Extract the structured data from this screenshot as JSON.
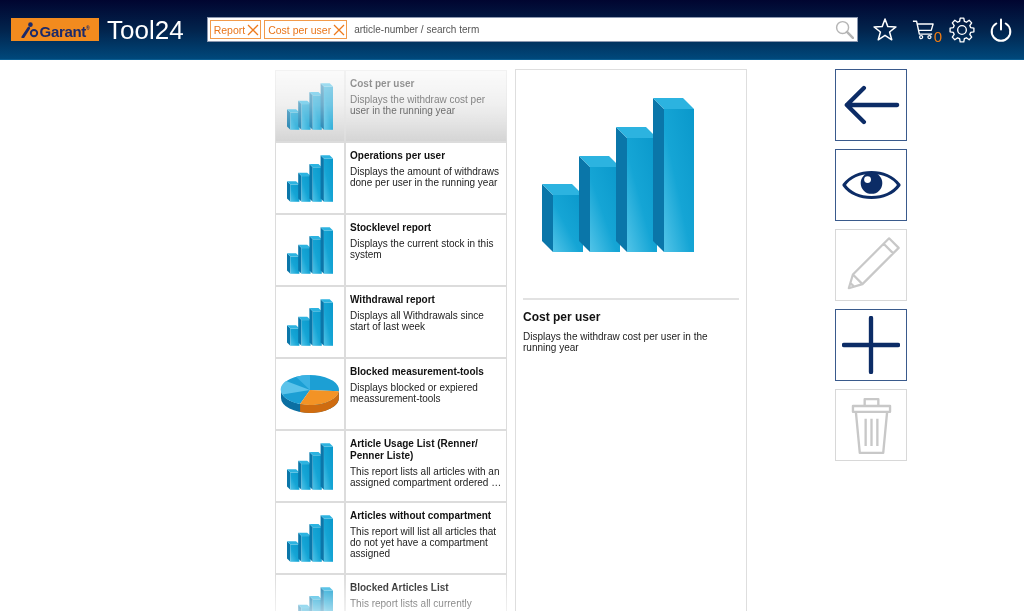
{
  "header": {
    "logo": {
      "text": "Garant$^{®}$"
    },
    "app_title": "Tool24",
    "search": {
      "tags": [
        {
          "label": "Report"
        },
        {
          "label": "Cost per user"
        }
      ],
      "placeholder": "article-number / search term"
    },
    "cart_count": "0"
  },
  "reports": [
    {
      "kind": "bar",
      "title": "Cost per user",
      "description": "Displays the withdraw cost per user in the running year",
      "selected": true
    },
    {
      "kind": "bar",
      "title": "Operations per user",
      "description": "Displays the amount of withdraws done per user in the running year",
      "selected": false
    },
    {
      "kind": "bar",
      "title": "Stocklevel report",
      "description": "Displays the current stock in this system",
      "selected": false
    },
    {
      "kind": "bar",
      "title": "Withdrawal report",
      "description": "Displays all Withdrawals since start of last week",
      "selected": false
    },
    {
      "kind": "pie",
      "title": "Blocked measurement-tools",
      "description": "Displays blocked or expiered meassurement-tools",
      "selected": false
    },
    {
      "kind": "bar",
      "title": "Article Usage List (Renner/ Penner Liste)",
      "description": "This report lists all articles with an assigned compartment ordered …",
      "selected": false
    },
    {
      "kind": "bar",
      "title": "Articles without compartment",
      "description": "This report will list all articles that do not yet have a compartment assigned",
      "selected": false
    },
    {
      "kind": "bar",
      "title": "Blocked Articles List",
      "description": "This report lists all currently",
      "selected": false
    }
  ],
  "detail": {
    "kind": "bar",
    "title": "Cost per user",
    "description": "Displays the withdraw cost per user in the running year"
  },
  "actions": [
    {
      "kind": "back",
      "disabled": false
    },
    {
      "kind": "view",
      "disabled": false
    },
    {
      "kind": "edit",
      "disabled": true
    },
    {
      "kind": "add",
      "disabled": false
    },
    {
      "kind": "delete",
      "disabled": true
    }
  ]
}
